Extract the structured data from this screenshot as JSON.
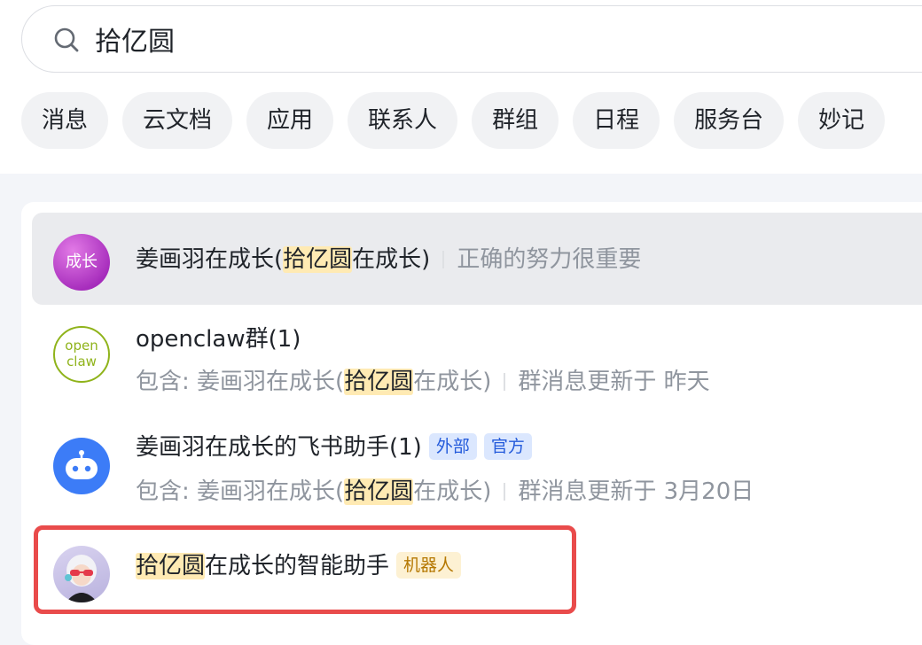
{
  "search": {
    "query": "拾亿圆"
  },
  "filters": [
    "消息",
    "云文档",
    "应用",
    "联系人",
    "群组",
    "日程",
    "服务台",
    "妙记"
  ],
  "results": [
    {
      "avatar_text": "成长",
      "title_pre": "姜画羽在成长(",
      "title_hl": "拾亿圆",
      "title_post": "在成长)",
      "signature": "正确的努力很重要"
    },
    {
      "avatar_text_1": "open",
      "avatar_text_2": "claw",
      "title": "openclaw群(1)",
      "sub_pre": "包含: 姜画羽在成长(",
      "sub_hl": "拾亿圆",
      "sub_post": "在成长)",
      "sub_meta": "群消息更新于 昨天"
    },
    {
      "title": "姜画羽在成长的飞书助手(1)",
      "tags": [
        "外部",
        "官方"
      ],
      "sub_pre": "包含: 姜画羽在成长(",
      "sub_hl": "拾亿圆",
      "sub_post": "在成长)",
      "sub_meta": "群消息更新于 3月20日"
    },
    {
      "title_hl": "拾亿圆",
      "title_post": "在成长的智能助手",
      "tag": "机器人"
    }
  ],
  "colors": {
    "accent_highlight": "#ffeab3",
    "selection_frame": "#e94b4b",
    "tag_blue_bg": "#dbe7fe",
    "tag_blue_text": "#245bdb",
    "tag_yellow_bg": "#fdf1d3",
    "tag_yellow_text": "#b57802"
  }
}
